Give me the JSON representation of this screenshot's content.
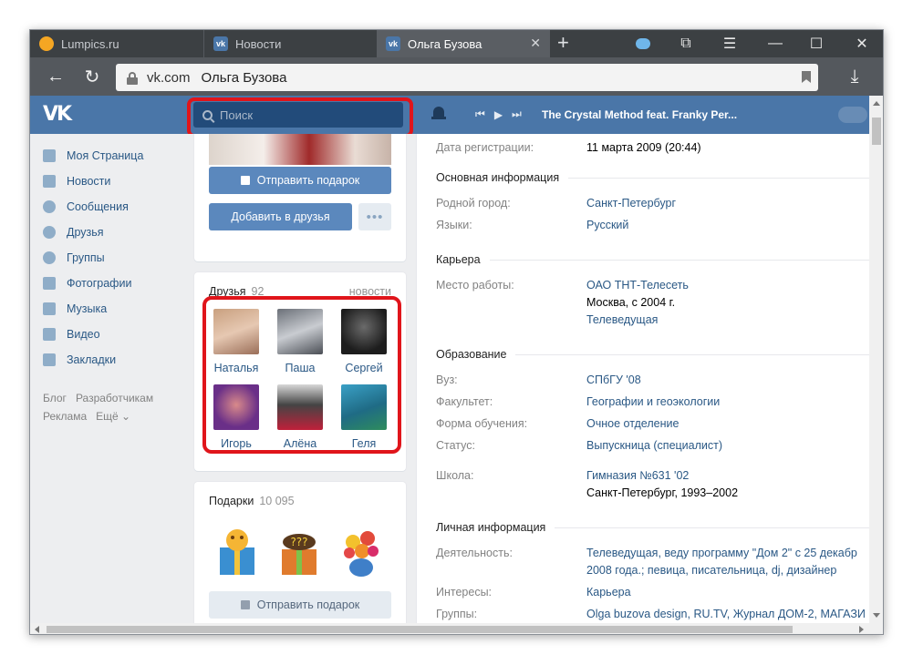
{
  "browser": {
    "tabs": [
      {
        "label": "Lumpics.ru",
        "icon": "lumpics-favicon"
      },
      {
        "label": "Новости",
        "icon": "vk-favicon"
      },
      {
        "label": "Ольга Бузова",
        "icon": "vk-favicon",
        "active": true
      }
    ],
    "url_domain": "vk.com",
    "url_title": "Ольга Бузова"
  },
  "vk": {
    "search_placeholder": "Поиск",
    "track": "The Crystal Method feat. Franky Per...",
    "nav": [
      {
        "label": "Моя Страница",
        "icon": "home-icon"
      },
      {
        "label": "Новости",
        "icon": "news-icon"
      },
      {
        "label": "Сообщения",
        "icon": "messages-icon"
      },
      {
        "label": "Друзья",
        "icon": "friend-icon"
      },
      {
        "label": "Группы",
        "icon": "groups-icon"
      },
      {
        "label": "Фотографии",
        "icon": "camera-icon"
      },
      {
        "label": "Музыка",
        "icon": "music-icon"
      },
      {
        "label": "Видео",
        "icon": "video-icon"
      },
      {
        "label": "Закладки",
        "icon": "star-icon"
      }
    ],
    "footer": {
      "blog": "Блог",
      "dev": "Разработчикам",
      "ads": "Реклама",
      "more": "Ещё ⌄"
    },
    "profile": {
      "send_gift": "Отправить подарок",
      "add_friend": "Добавить в друзья",
      "more": "•••"
    },
    "friends": {
      "title": "Друзья",
      "count": "92",
      "news": "новости",
      "list": [
        {
          "name": "Наталья",
          "color": "#d7a98a"
        },
        {
          "name": "Паша",
          "color": "#9a9ea4"
        },
        {
          "name": "Сергей",
          "color": "#3b3b3b"
        },
        {
          "name": "Игорь",
          "color": "#7d3a8c"
        },
        {
          "name": "Алёна",
          "color": "#b8223a"
        },
        {
          "name": "Геля",
          "color": "#2f8aa8"
        }
      ]
    },
    "gifts": {
      "title": "Подарки",
      "count": "10 095",
      "send_gift": "Отправить подарок"
    },
    "info": {
      "reg_label": "Дата регистрации:",
      "reg_value": "11 марта 2009 (20:44)",
      "basic_head": "Основная информация",
      "city_label": "Родной город:",
      "city_value": "Санкт-Петербург",
      "lang_label": "Языки:",
      "lang_value": "Русский",
      "career_head": "Карьера",
      "work_label": "Место работы:",
      "work_value": "ОАО ТНТ-Телесеть",
      "work_city": "Москва, с 2004 г.",
      "work_role": "Телеведущая",
      "edu_head": "Образование",
      "uni_label": "Вуз:",
      "uni_value": "СПбГУ '08",
      "fac_label": "Факультет:",
      "fac_value": "Географии и геоэкологии",
      "form_label": "Форма обучения:",
      "form_value": "Очное отделение",
      "status_label": "Статус:",
      "status_value": "Выпускница (специалист)",
      "school_label": "Школа:",
      "school_value": "Гимназия №631 '02",
      "school_years": "Санкт-Петербург, 1993–2002",
      "personal_head": "Личная информация",
      "act_label": "Деятельность:",
      "act_value1": "Телеведущая, веду программу \"Дом 2\" с 25 декабр",
      "act_value2": "2008 года.; певица, писательница, dj, дизайнер",
      "int_label": "Интересы:",
      "int_value": "Карьера",
      "groups_label": "Группы:",
      "groups_value": "Olga buzova design, RU.TV, Журнал ДОМ-2, МАГАЗИ"
    }
  }
}
